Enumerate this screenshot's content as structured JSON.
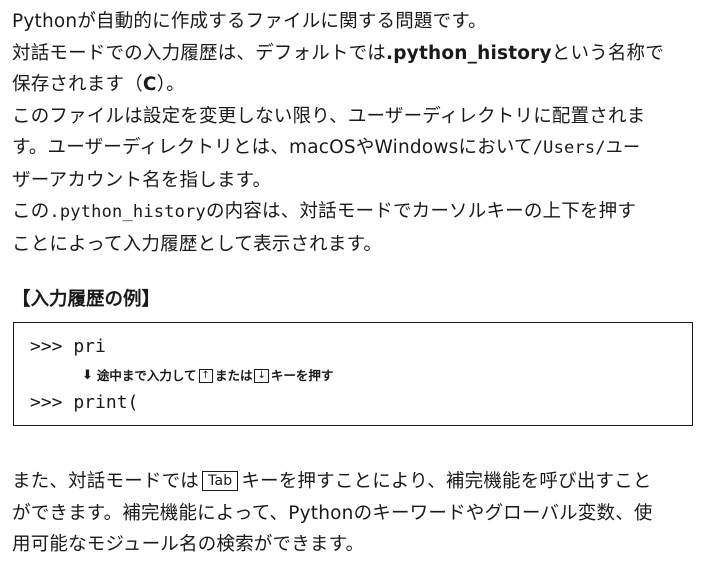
{
  "paragraphs": {
    "p1": "Pythonが自動的に作成するファイルに関する問題です。",
    "p2_a": "対話モードでの入力履歴は、デフォルトでは",
    "p2_file": ".python_history",
    "p2_b": "という名称で",
    "p2_c": "保存されます（",
    "p2_answer": "C",
    "p2_d": "）。",
    "p3_a": "このファイルは設定を変更しない限り、ユーザーディレクトリに配置されま",
    "p3_b": "す。ユーザーディレクトリとは、macOSやWindowsにおいて",
    "p3_path": "/Users/ユー",
    "p3_c": "ザーアカウント名を指します。",
    "p4_a": "この",
    "p4_file": ".python_history",
    "p4_b": "の内容は、対話モードでカーソルキーの上下を押す",
    "p4_c": "ことによって入力履歴として表示されます。"
  },
  "example": {
    "heading": "【入力履歴の例】",
    "line1": ">>> pri",
    "instr_arrow": "⬇",
    "instr_a": "途中まで入力して",
    "key_up": "↑",
    "instr_b": "または",
    "key_down": "↓",
    "instr_c": "キーを押す",
    "line2": ">>> print("
  },
  "closing": {
    "a": "また、対話モードでは",
    "tab_key": "Tab",
    "b": "キーを押すことにより、補完機能を呼び出すこと",
    "c": "ができます。補完機能によって、Pythonのキーワードやグローバル変数、使",
    "d": "用可能なモジュール名の検索ができます。"
  }
}
